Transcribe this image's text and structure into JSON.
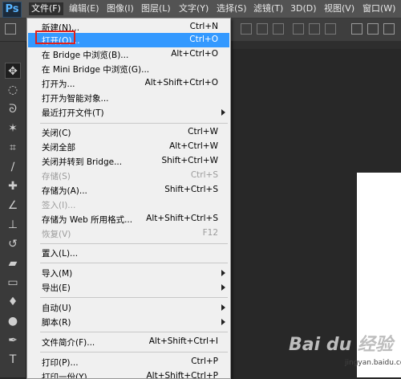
{
  "app": {
    "logo": "Ps"
  },
  "menubar": [
    {
      "label": "文件(F)"
    },
    {
      "label": "编辑(E)"
    },
    {
      "label": "图像(I)"
    },
    {
      "label": "图层(L)"
    },
    {
      "label": "文字(Y)"
    },
    {
      "label": "选择(S)"
    },
    {
      "label": "滤镜(T)"
    },
    {
      "label": "3D(D)"
    },
    {
      "label": "视图(V)"
    },
    {
      "label": "窗口(W)"
    }
  ],
  "file_menu": {
    "items": [
      {
        "label": "新建(N)...",
        "shortcut": "Ctrl+N"
      },
      {
        "label": "打开(O)...",
        "shortcut": "Ctrl+O"
      },
      {
        "label": "在 Bridge 中浏览(B)...",
        "shortcut": "Alt+Ctrl+O"
      },
      {
        "label": "在 Mini Bridge 中浏览(G)...",
        "shortcut": ""
      },
      {
        "label": "打开为...",
        "shortcut": "Alt+Shift+Ctrl+O"
      },
      {
        "label": "打开为智能对象...",
        "shortcut": ""
      },
      {
        "label": "最近打开文件(T)",
        "shortcut": ""
      },
      {
        "label": "关闭(C)",
        "shortcut": "Ctrl+W"
      },
      {
        "label": "关闭全部",
        "shortcut": "Alt+Ctrl+W"
      },
      {
        "label": "关闭并转到 Bridge...",
        "shortcut": "Shift+Ctrl+W"
      },
      {
        "label": "存储(S)",
        "shortcut": "Ctrl+S"
      },
      {
        "label": "存储为(A)...",
        "shortcut": "Shift+Ctrl+S"
      },
      {
        "label": "签入(I)...",
        "shortcut": ""
      },
      {
        "label": "存储为 Web 所用格式...",
        "shortcut": "Alt+Shift+Ctrl+S"
      },
      {
        "label": "恢复(V)",
        "shortcut": "F12"
      },
      {
        "label": "置入(L)...",
        "shortcut": ""
      },
      {
        "label": "导入(M)",
        "shortcut": ""
      },
      {
        "label": "导出(E)",
        "shortcut": ""
      },
      {
        "label": "自动(U)",
        "shortcut": ""
      },
      {
        "label": "脚本(R)",
        "shortcut": ""
      },
      {
        "label": "文件简介(F)...",
        "shortcut": "Alt+Shift+Ctrl+I"
      },
      {
        "label": "打印(P)...",
        "shortcut": "Ctrl+P"
      },
      {
        "label": "打印一份(Y)",
        "shortcut": "Alt+Shift+Ctrl+P"
      }
    ]
  },
  "watermark": {
    "brand": "Bai du 经验",
    "url": "jingyan.baidu.com"
  }
}
